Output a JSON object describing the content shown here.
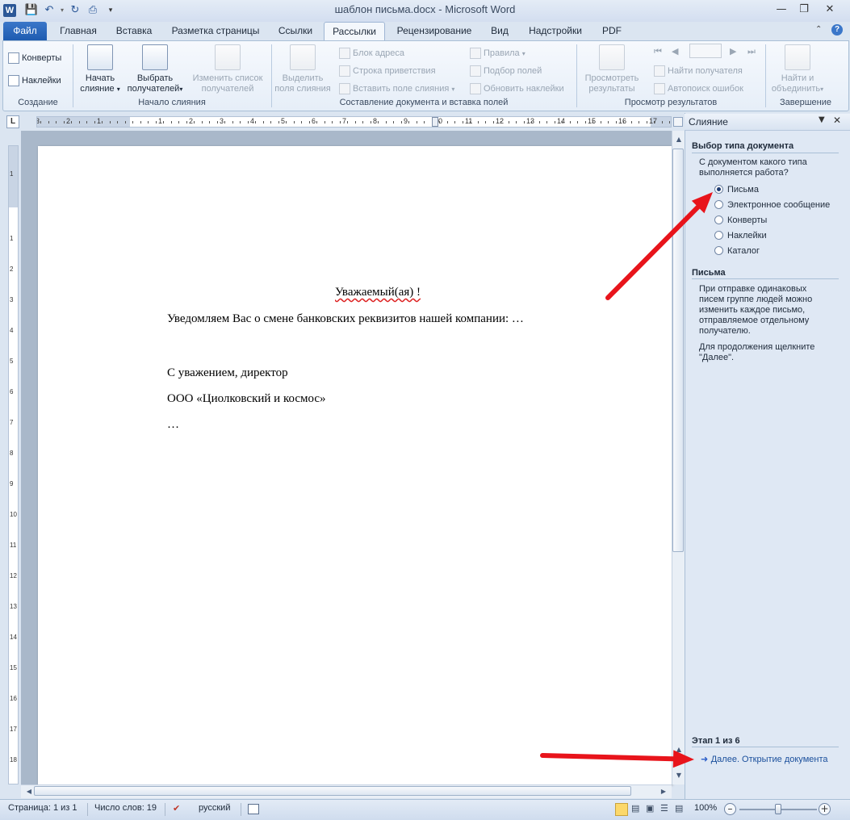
{
  "window": {
    "title": "шаблон письма.docx - Microsoft Word",
    "app_icon_letter": "W"
  },
  "tabs": [
    {
      "label": "Файл"
    },
    {
      "label": "Главная"
    },
    {
      "label": "Вставка"
    },
    {
      "label": "Разметка страницы"
    },
    {
      "label": "Ссылки"
    },
    {
      "label": "Рассылки"
    },
    {
      "label": "Рецензирование"
    },
    {
      "label": "Вид"
    },
    {
      "label": "Надстройки"
    },
    {
      "label": "PDF"
    }
  ],
  "ribbon": {
    "create": {
      "envelopes": "Конверты",
      "labels": "Наклейки",
      "group": "Создание"
    },
    "start": {
      "start_merge_1": "Начать",
      "start_merge_2": "слияние",
      "select_recipients_1": "Выбрать",
      "select_recipients_2": "получателей",
      "edit_list_1": "Изменить список",
      "edit_list_2": "получателей",
      "group": "Начало слияния"
    },
    "write": {
      "highlight_1": "Выделить",
      "highlight_2": "поля слияния",
      "address_block": "Блок адреса",
      "greeting_line": "Строка приветствия",
      "insert_field": "Вставить поле слияния",
      "rules": "Правила",
      "match_fields": "Подбор полей",
      "update_labels": "Обновить наклейки",
      "group": "Составление документа и вставка полей"
    },
    "preview": {
      "preview_1": "Просмотреть",
      "preview_2": "результаты",
      "find_recipient": "Найти получателя",
      "auto_check": "Автопоиск ошибок",
      "group": "Просмотр результатов"
    },
    "finish": {
      "finish_1": "Найти и",
      "finish_2": "объединить",
      "group": "Завершение"
    }
  },
  "ruler": {
    "corner": "L",
    "h_numbers": [
      "3",
      "2",
      "1",
      "1",
      "2",
      "3",
      "4",
      "5",
      "6",
      "7",
      "8",
      "9",
      "10",
      "11",
      "12",
      "13",
      "14",
      "15",
      "16",
      "17"
    ],
    "v_numbers": [
      "1",
      "1",
      "2",
      "3",
      "4",
      "5",
      "6",
      "7",
      "8",
      "9",
      "10",
      "11",
      "12",
      "13",
      "14",
      "15",
      "16",
      "17",
      "18"
    ]
  },
  "document": {
    "greeting": "Уважаемый(ая)  !",
    "body": "Уведомляем Вас о смене банковских реквизитов нашей компании: …",
    "regards": "С уважением, директор",
    "company": "ООО «Циолковский и космос»",
    "ellipsis": "…"
  },
  "pane": {
    "title": "Слияние",
    "section_select": "Выбор типа документа",
    "question": "С документом какого типа выполняется работа?",
    "options": [
      {
        "label": "Письма",
        "selected": true
      },
      {
        "label": "Электронное сообщение",
        "selected": false
      },
      {
        "label": "Конверты",
        "selected": false
      },
      {
        "label": "Наклейки",
        "selected": false
      },
      {
        "label": "Каталог",
        "selected": false
      }
    ],
    "section_letters": "Письма",
    "letters_desc": "При отправке одинаковых писем группе людей можно изменить каждое письмо, отправляемое отдельному получателю.",
    "continue_hint": "Для продолжения щелкните \"Далее\".",
    "step": "Этап 1 из 6",
    "next_link": "Далее. Открытие документа"
  },
  "status": {
    "page": "Страница: 1 из 1",
    "words": "Число слов: 19",
    "language": "русский",
    "zoom": "100%",
    "zoom_level": 0.5
  },
  "colors": {
    "accent": "#2b5797",
    "arrow": "#e8141b"
  }
}
